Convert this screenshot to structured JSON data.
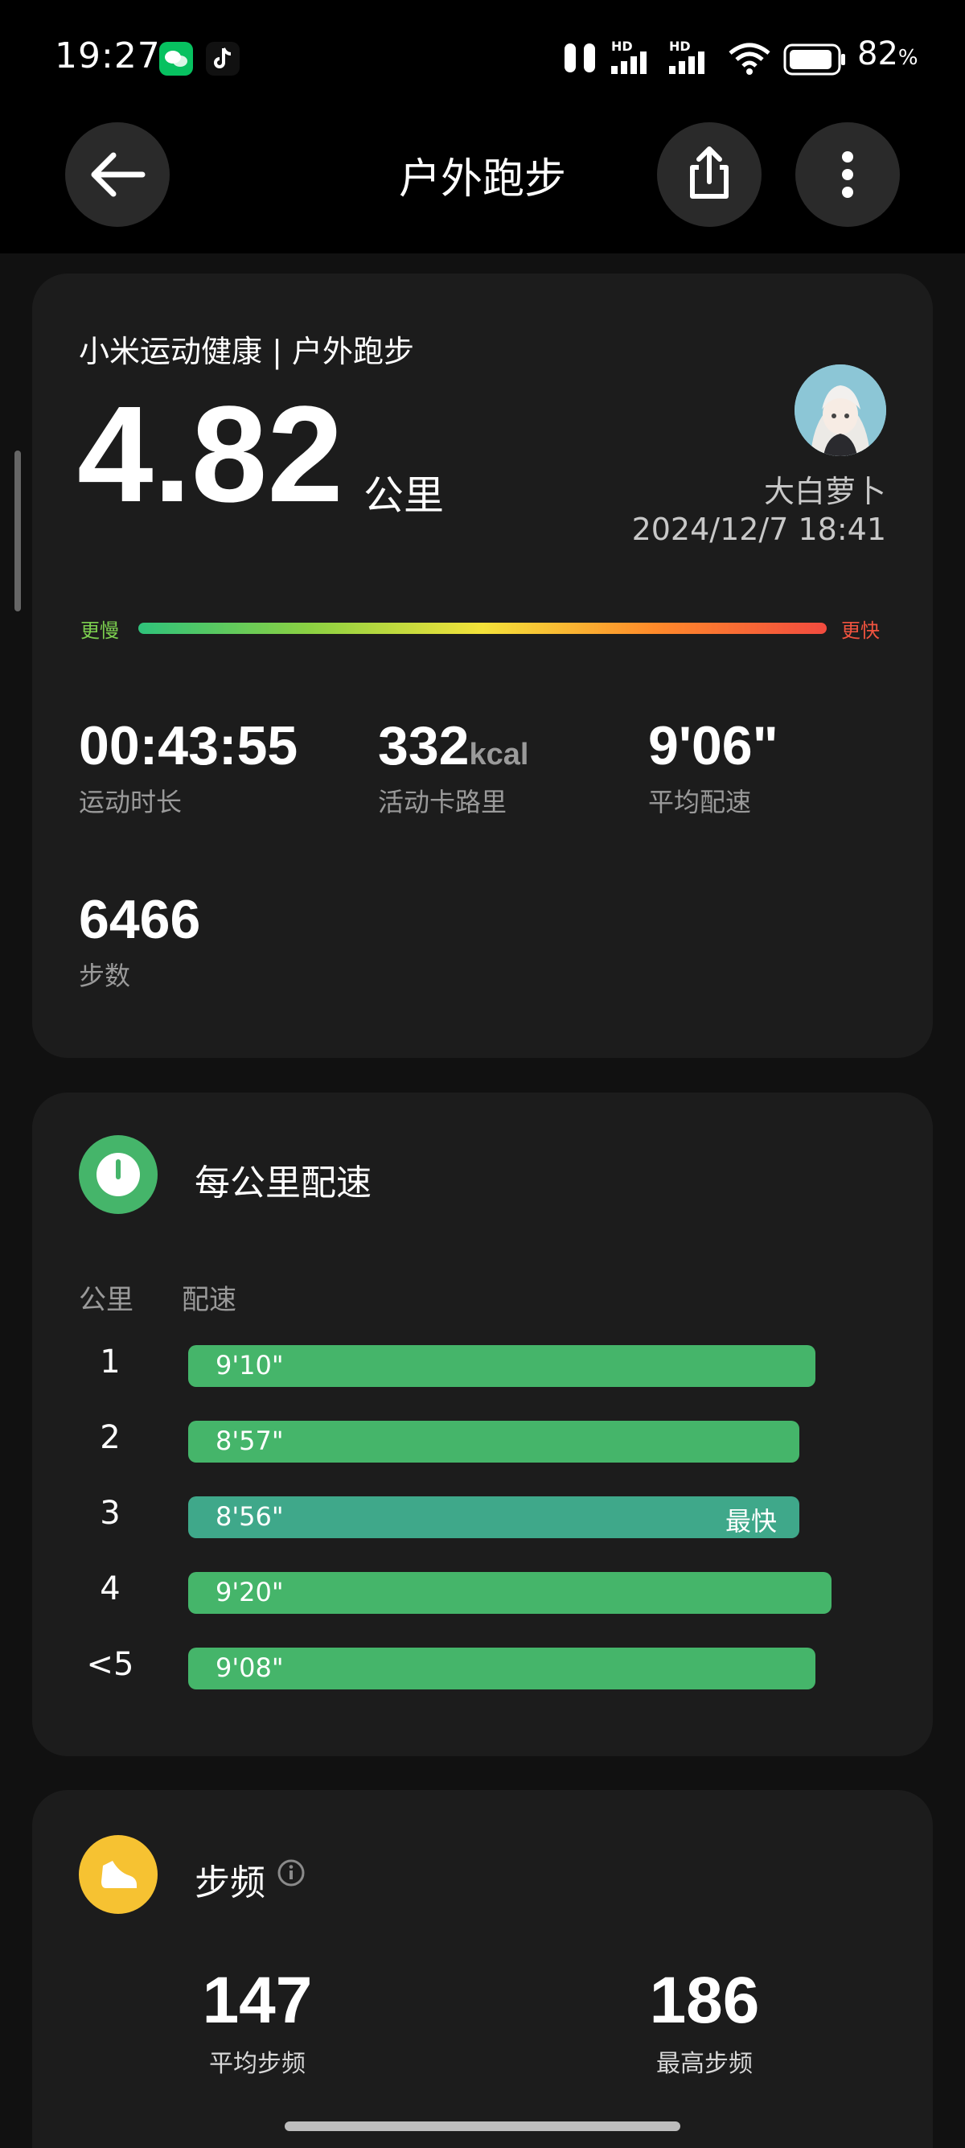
{
  "status_bar": {
    "time": "19:27",
    "network_label_1": "HD",
    "network_label_2": "HD",
    "battery": "82",
    "battery_unit": "%"
  },
  "nav": {
    "title": "户外跑步",
    "back_icon": "arrow-left-icon",
    "share_icon": "share-icon",
    "more_icon": "more-vertical-icon"
  },
  "summary": {
    "source": "小米运动健康 | 户外跑步",
    "distance": "4.82",
    "distance_unit": "公里",
    "user_name": "大白萝卜",
    "datetime": "2024/12/7 18:41",
    "slower_label": "更慢",
    "faster_label": "更快",
    "duration": "00:43:55",
    "duration_label": "运动时长",
    "calories": "332",
    "calories_unit": "kcal",
    "calories_label": "活动卡路里",
    "avg_pace": "9'06\"",
    "avg_pace_label": "平均配速",
    "steps": "6466",
    "steps_label": "步数"
  },
  "pace_card": {
    "title": "每公里配速",
    "col_km": "公里",
    "col_pace": "配速",
    "fastest_label": "最快",
    "rows": [
      {
        "km": "1",
        "pace": "9'10\"",
        "fraction": 0.78
      },
      {
        "km": "2",
        "pace": "8'57\"",
        "fraction": 0.76
      },
      {
        "km": "3",
        "pace": "8'56\"",
        "fraction": 0.76,
        "fastest": true
      },
      {
        "km": "4",
        "pace": "9'20\"",
        "fraction": 0.8
      },
      {
        "km": "<5",
        "pace": "9'08\"",
        "fraction": 0.78
      }
    ]
  },
  "cadence_card": {
    "title": "步频",
    "avg_value": "147",
    "avg_label": "平均步频",
    "max_value": "186",
    "max_label": "最高步频"
  },
  "colors": {
    "accent_green": "#45b56a",
    "fastest_bar": "#3fa88a",
    "cadence_icon": "#f6c232",
    "slower": "#7ccf4f",
    "faster": "#f0533f"
  }
}
